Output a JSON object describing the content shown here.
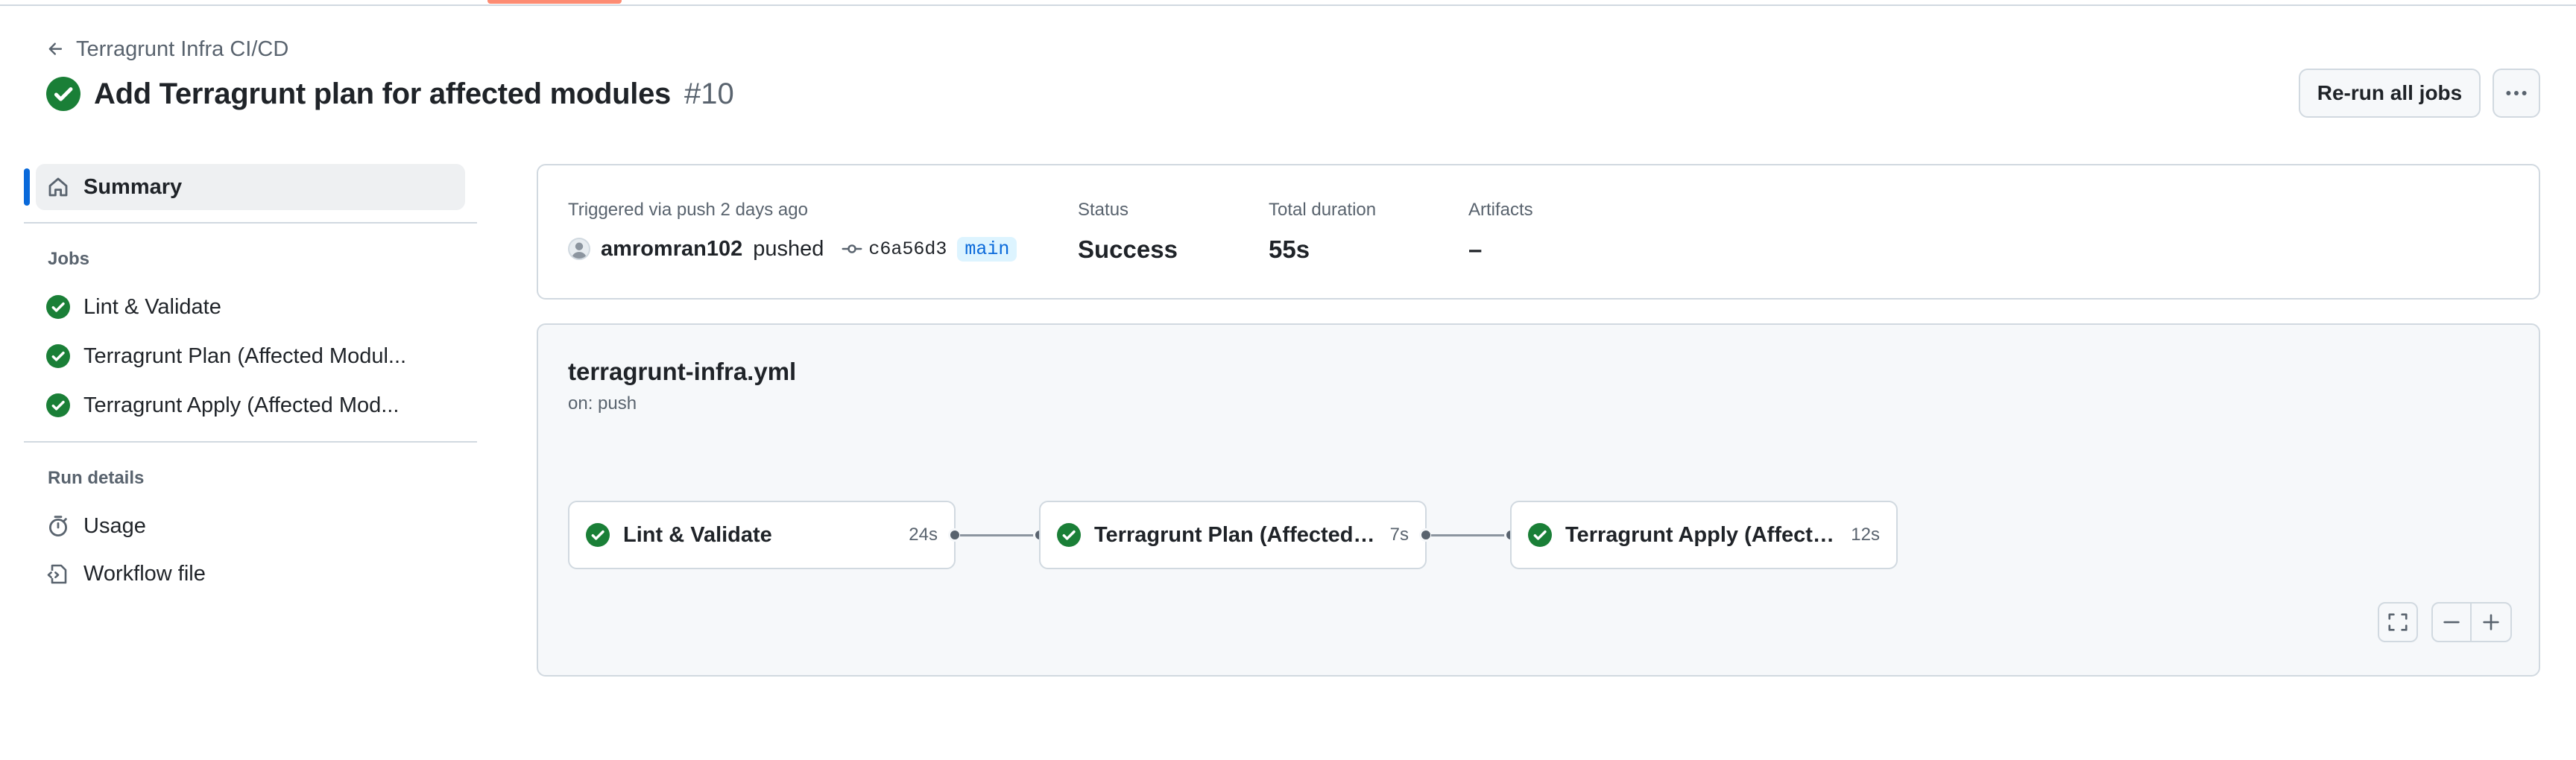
{
  "breadcrumb": {
    "label": "Terragrunt Infra CI/CD"
  },
  "header": {
    "title": "Add Terragrunt plan for affected modules",
    "run_number": "#10",
    "rerun_label": "Re-run all jobs",
    "more_icon": "kebab-horizontal-icon"
  },
  "sidebar": {
    "summary_label": "Summary",
    "jobs_heading": "Jobs",
    "jobs": [
      {
        "label": "Lint & Validate",
        "status": "success"
      },
      {
        "label": "Terragrunt Plan (Affected Modul...",
        "status": "success"
      },
      {
        "label": "Terragrunt Apply (Affected Mod...",
        "status": "success"
      }
    ],
    "run_details_heading": "Run details",
    "run_details": [
      {
        "label": "Usage",
        "icon": "stopwatch-icon"
      },
      {
        "label": "Workflow file",
        "icon": "file-code-icon"
      }
    ]
  },
  "summary": {
    "trigger_label": "Triggered via push 2 days ago",
    "user": "amromran102",
    "action": "pushed",
    "commit": "c6a56d3",
    "branch": "main",
    "status_label": "Status",
    "status_value": "Success",
    "duration_label": "Total duration",
    "duration_value": "55s",
    "artifacts_label": "Artifacts",
    "artifacts_value": "–"
  },
  "workflow": {
    "file": "terragrunt-infra.yml",
    "trigger": "on: push",
    "jobs": [
      {
        "name": "Lint & Validate",
        "duration": "24s"
      },
      {
        "name": "Terragrunt Plan (Affected ...",
        "duration": "7s"
      },
      {
        "name": "Terragrunt Apply (Affecte...",
        "duration": "12s"
      }
    ]
  },
  "colors": {
    "success": "#1a7f37",
    "accent": "#0969da",
    "tab_accent": "#fd8c73"
  }
}
